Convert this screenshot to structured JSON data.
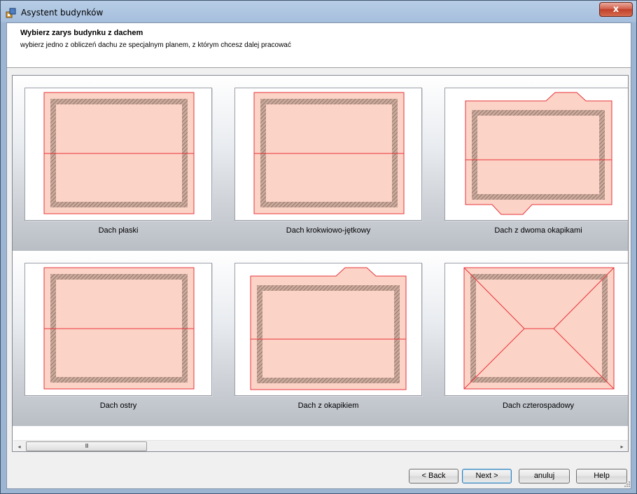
{
  "window": {
    "title": "Asystent budynków",
    "close_label": "x"
  },
  "header": {
    "title": "Wybierz zarys budynku z dachem",
    "subtitle": "wybierz jedno z obliczeń dachu ze specjalnym planem, z którym chcesz dalej pracować"
  },
  "options": [
    {
      "label": "Dach płaski"
    },
    {
      "label": "Dach krokwiowo-jętkowy"
    },
    {
      "label": "Dach z dwoma okapikami"
    },
    {
      "label": "Dach ostry"
    },
    {
      "label": "Dach z okapikiem"
    },
    {
      "label": "Dach czterospadowy"
    }
  ],
  "scrollbar": {
    "left_arrow": "◂",
    "right_arrow": "▸",
    "thumb_grip": "III"
  },
  "buttons": {
    "back": "< Back",
    "next": "Next >",
    "cancel": "anuluj",
    "help": "Help"
  },
  "colors": {
    "roof_fill": "#fcd3c7",
    "roof_line": "#e8333a",
    "wall_hatch": "#a58676"
  }
}
